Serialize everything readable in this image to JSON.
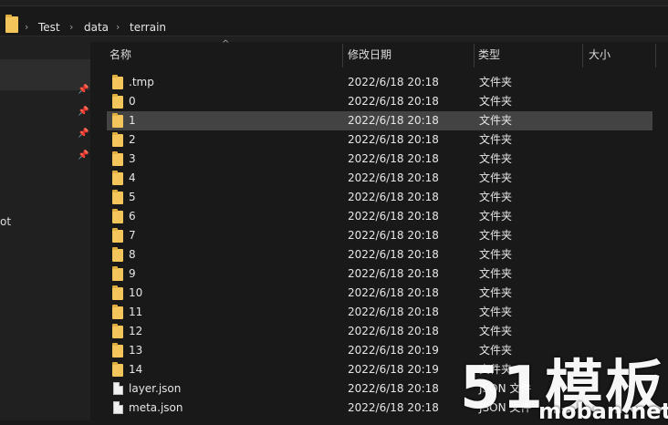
{
  "breadcrumb": {
    "items": [
      "Test",
      "data",
      "terrain"
    ]
  },
  "nav": {
    "partial_label": "ot"
  },
  "columns": {
    "name": "名称",
    "date": "修改日期",
    "type": "类型",
    "size": "大小"
  },
  "files": [
    {
      "name": ".tmp",
      "date": "2022/6/18 20:18",
      "type": "文件夹",
      "icon": "folder-icon"
    },
    {
      "name": "0",
      "date": "2022/6/18 20:18",
      "type": "文件夹",
      "icon": "folder-icon"
    },
    {
      "name": "1",
      "date": "2022/6/18 20:18",
      "type": "文件夹",
      "icon": "folder-icon",
      "selected": true
    },
    {
      "name": "2",
      "date": "2022/6/18 20:18",
      "type": "文件夹",
      "icon": "folder-icon"
    },
    {
      "name": "3",
      "date": "2022/6/18 20:18",
      "type": "文件夹",
      "icon": "folder-icon"
    },
    {
      "name": "4",
      "date": "2022/6/18 20:18",
      "type": "文件夹",
      "icon": "folder-icon"
    },
    {
      "name": "5",
      "date": "2022/6/18 20:18",
      "type": "文件夹",
      "icon": "folder-icon"
    },
    {
      "name": "6",
      "date": "2022/6/18 20:18",
      "type": "文件夹",
      "icon": "folder-icon"
    },
    {
      "name": "7",
      "date": "2022/6/18 20:18",
      "type": "文件夹",
      "icon": "folder-icon"
    },
    {
      "name": "8",
      "date": "2022/6/18 20:18",
      "type": "文件夹",
      "icon": "folder-icon"
    },
    {
      "name": "9",
      "date": "2022/6/18 20:18",
      "type": "文件夹",
      "icon": "folder-icon"
    },
    {
      "name": "10",
      "date": "2022/6/18 20:18",
      "type": "文件夹",
      "icon": "folder-icon"
    },
    {
      "name": "11",
      "date": "2022/6/18 20:18",
      "type": "文件夹",
      "icon": "folder-icon"
    },
    {
      "name": "12",
      "date": "2022/6/18 20:18",
      "type": "文件夹",
      "icon": "folder-icon"
    },
    {
      "name": "13",
      "date": "2022/6/18 20:19",
      "type": "文件夹",
      "icon": "folder-icon"
    },
    {
      "name": "14",
      "date": "2022/6/18 20:19",
      "type": "文件夹",
      "icon": "folder-icon"
    },
    {
      "name": "layer.json",
      "date": "2022/6/18 20:18",
      "type": "JSON 文件",
      "icon": "json-file-icon"
    },
    {
      "name": "meta.json",
      "date": "2022/6/18 20:18",
      "type": "JSON 文件",
      "icon": "json-file-icon"
    }
  ],
  "watermark": {
    "main": "51模板",
    "sub": "moban.net"
  },
  "colors": {
    "folder": "#f3c55a",
    "selected_row": "#434343",
    "background": "#191919"
  }
}
